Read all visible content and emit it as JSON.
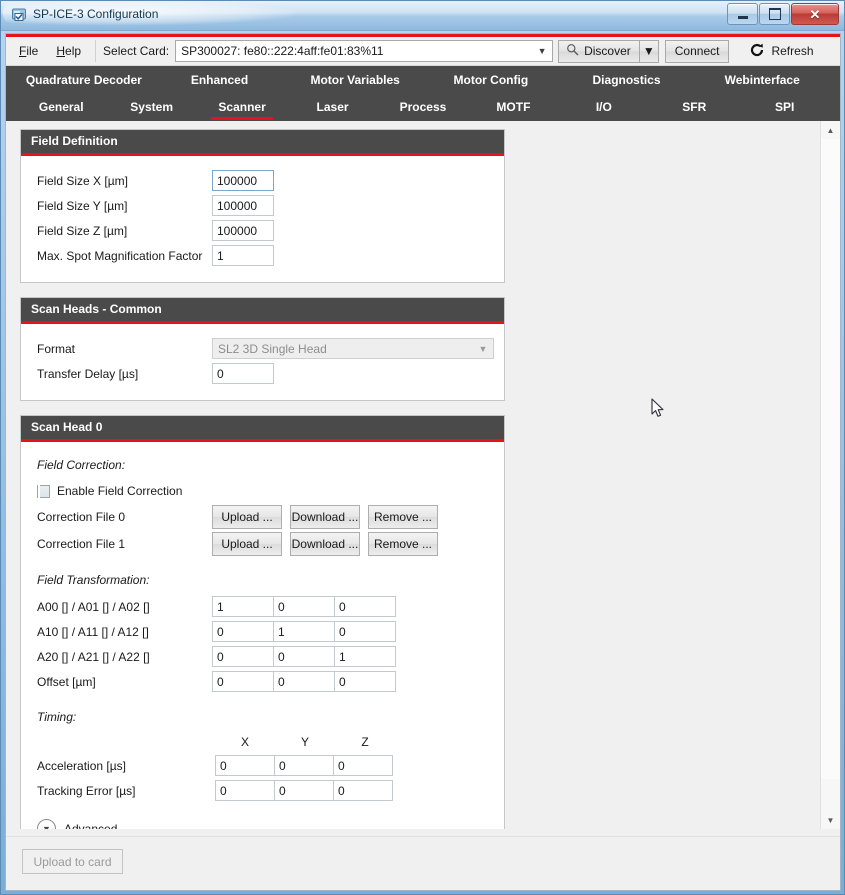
{
  "window": {
    "title": "SP-ICE-3 Configuration",
    "app_icon": "card-check-icon",
    "minimize_label": "Minimize",
    "maximize_label": "Maximize",
    "close_label": "✕",
    "accent_red": "#e8131a",
    "header_grey": "#4a4a4a"
  },
  "toolbar": {
    "menus": [
      {
        "label": "File",
        "mnemonic": "F",
        "rest": "ile"
      },
      {
        "label": "Help",
        "mnemonic": "H",
        "rest": "elp"
      }
    ],
    "select_card_label": "Select Card:",
    "select_card_value": "SP300027: fe80::222:4aff:fe01:83%11",
    "discover_label": "Discover",
    "connect_label": "Connect",
    "refresh_label": "Refresh",
    "refresh_enabled": false
  },
  "tabs_row1": [
    {
      "label": "Quadrature Decoder",
      "active": false
    },
    {
      "label": "Enhanced",
      "active": false
    },
    {
      "label": "Motor Variables",
      "active": false
    },
    {
      "label": "Motor Config",
      "active": false
    },
    {
      "label": "Diagnostics",
      "active": false
    },
    {
      "label": "Webinterface",
      "active": false
    }
  ],
  "tabs_row2": [
    {
      "label": "General",
      "active": false
    },
    {
      "label": "System",
      "active": false
    },
    {
      "label": "Scanner",
      "active": true
    },
    {
      "label": "Laser",
      "active": false
    },
    {
      "label": "Process",
      "active": false
    },
    {
      "label": "MOTF",
      "active": false
    },
    {
      "label": "I/O",
      "active": false
    },
    {
      "label": "SFR",
      "active": false
    },
    {
      "label": "SPI",
      "active": false
    }
  ],
  "field_definition": {
    "title": "Field Definition",
    "rows": [
      {
        "label": "Field Size X [µm]",
        "value": "100000"
      },
      {
        "label": "Field Size Y [µm]",
        "value": "100000"
      },
      {
        "label": "Field Size Z [µm]",
        "value": "100000"
      },
      {
        "label": "Max. Spot Magnification Factor",
        "value": "1"
      }
    ]
  },
  "scan_heads_common": {
    "title": "Scan Heads - Common",
    "format_label": "Format",
    "format_value": "SL2 3D Single Head",
    "transfer_delay_label": "Transfer Delay [µs]",
    "transfer_delay_value": "0"
  },
  "scan_head_0": {
    "title": "Scan Head 0",
    "field_correction_heading": "Field Correction:",
    "enable_field_correction_label": "Enable Field Correction",
    "enable_field_correction_checked": false,
    "correction_files": [
      {
        "label": "Correction File 0",
        "upload": "Upload ...",
        "download": "Download ...",
        "remove": "Remove ..."
      },
      {
        "label": "Correction File 1",
        "upload": "Upload ...",
        "download": "Download ...",
        "remove": "Remove ..."
      }
    ],
    "field_transformation_heading": "Field Transformation:",
    "transformation_rows": [
      {
        "label": "A00 [] / A01 [] / A02 []",
        "values": [
          "1",
          "0",
          "0"
        ]
      },
      {
        "label": "A10 [] / A11 [] / A12 []",
        "values": [
          "0",
          "1",
          "0"
        ]
      },
      {
        "label": "A20 [] / A21 [] / A22 []",
        "values": [
          "0",
          "0",
          "1"
        ]
      },
      {
        "label": "Offset [µm]",
        "values": [
          "0",
          "0",
          "0"
        ]
      }
    ],
    "timing_heading": "Timing:",
    "timing_columns": [
      "X",
      "Y",
      "Z"
    ],
    "timing_rows": [
      {
        "label": "Acceleration [µs]",
        "values": [
          "0",
          "0",
          "0"
        ]
      },
      {
        "label": "Tracking Error [µs]",
        "values": [
          "0",
          "0",
          "0"
        ]
      }
    ],
    "advanced_label": "Advanced",
    "advanced_expanded": false
  },
  "bottom": {
    "upload_to_card_label": "Upload to card",
    "upload_to_card_enabled": false
  },
  "scrollbar": {
    "up_arrow": "▲",
    "down_arrow": "▼"
  }
}
